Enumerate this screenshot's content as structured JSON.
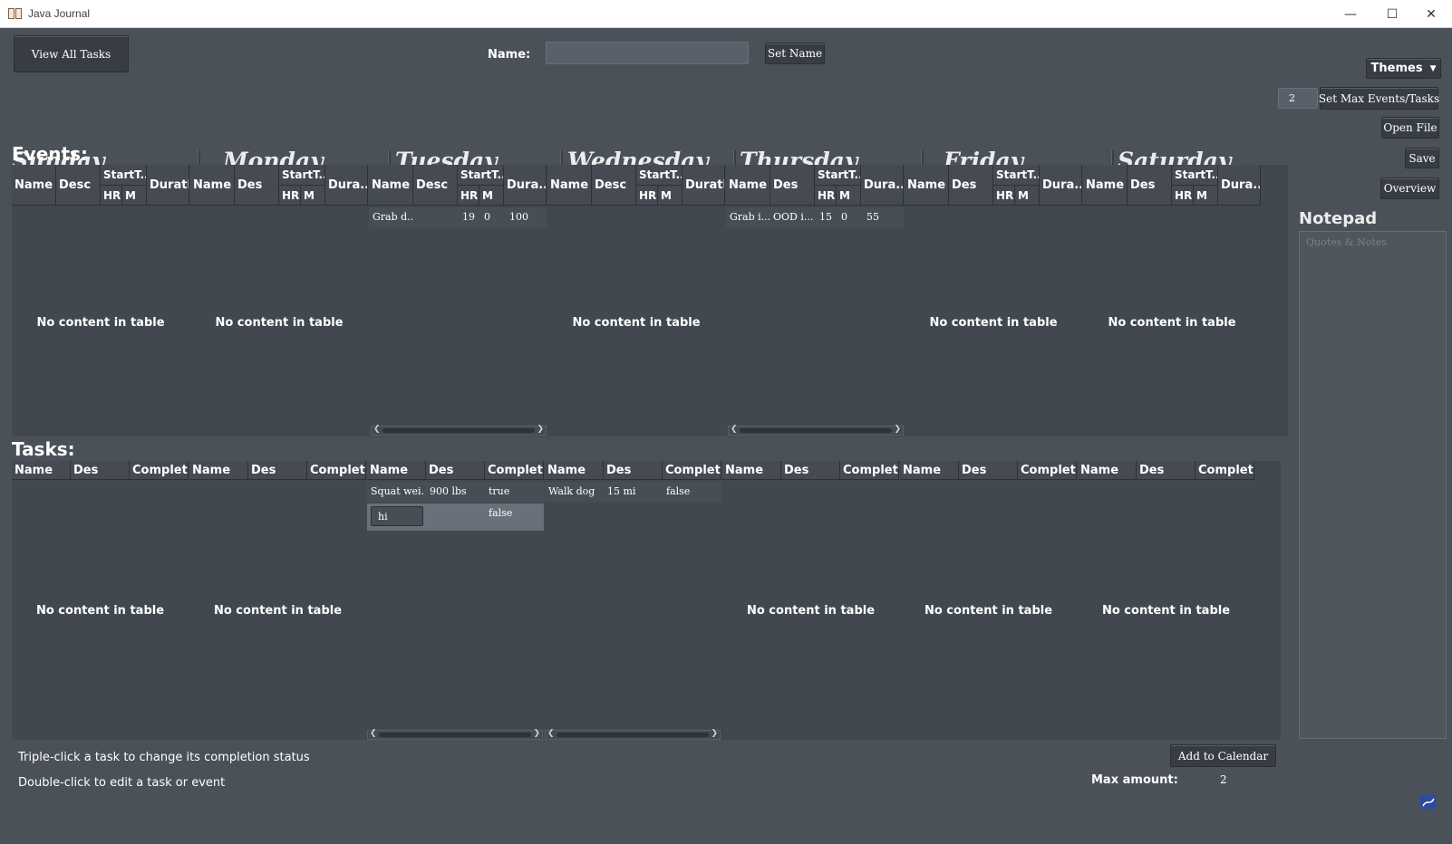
{
  "window": {
    "title": "Java Journal"
  },
  "toolbar": {
    "view_all_tasks": "View All Tasks",
    "name_label": "Name:",
    "name_value": "",
    "set_name": "Set Name",
    "themes": "Themes",
    "max_events_value": "2",
    "set_max": "Set Max Events/Tasks",
    "open_file": "Open File",
    "save": "Save",
    "overview": "Overview"
  },
  "days": [
    "Sunday",
    "Monday",
    "Tuesday",
    "Wednesday",
    "Thursday",
    "Friday",
    "Saturday"
  ],
  "events": {
    "title": "Events:",
    "empty_text": "No content in table",
    "columns": [
      {
        "name": "Name",
        "desc": "Desc",
        "start": "StartT...",
        "hr": "HR",
        "m": "M",
        "dur": "Duratic"
      },
      {
        "name": "Name",
        "desc": "Des",
        "start": "StartT...",
        "hr": "HR",
        "m": "M",
        "dur": "Dura..."
      },
      {
        "name": "Name",
        "desc": "Desc",
        "start": "StartT...",
        "hr": "HR",
        "m": "M",
        "dur": "Dura..."
      },
      {
        "name": "Name",
        "desc": "Desc",
        "start": "StartT...",
        "hr": "HR",
        "m": "M",
        "dur": "Duratic"
      },
      {
        "name": "Name",
        "desc": "Des",
        "start": "StartT...",
        "hr": "HR",
        "m": "M",
        "dur": "Dura..."
      },
      {
        "name": "Name",
        "desc": "Des",
        "start": "StartT...",
        "hr": "HR",
        "m": "M",
        "dur": "Dura..."
      },
      {
        "name": "Name",
        "desc": "Des",
        "start": "StartT...",
        "hr": "HR",
        "m": "M",
        "dur": "Dura..."
      }
    ],
    "tuesday_row": {
      "name": "Grab d...",
      "desc": "",
      "hr": "19",
      "m": "0",
      "dur": "100"
    },
    "thursday_row": {
      "name": "Grab i...",
      "desc": "OOD i...",
      "hr": "15",
      "m": "0",
      "dur": "55"
    }
  },
  "tasks": {
    "title": "Tasks:",
    "empty_text": "No content in table",
    "columns": [
      {
        "name": "Name",
        "des": "Des",
        "complete": "Complete"
      },
      {
        "name": "Name",
        "des": "Des",
        "complete": "Complete"
      },
      {
        "name": "Name",
        "des": "Des",
        "complete": "Complete"
      },
      {
        "name": "Name",
        "des": "Des",
        "complete": "Complete"
      },
      {
        "name": "Name",
        "des": "Des",
        "complete": "Complete"
      },
      {
        "name": "Name",
        "des": "Des",
        "complete": "Complete"
      },
      {
        "name": "Name",
        "des": "Des",
        "complete": "Complete"
      }
    ],
    "tuesday_rows": [
      {
        "name": "Squat wei...",
        "des": "900 lbs",
        "complete": "true"
      },
      {
        "name": "hi",
        "des": "",
        "complete": "false"
      }
    ],
    "wednesday_rows": [
      {
        "name": "Walk dog",
        "des": "15 mi",
        "complete": "false"
      }
    ]
  },
  "notepad": {
    "title": "Notepad",
    "placeholder": "Quotes & Notes"
  },
  "footer": {
    "hint1": "Triple-click a task to change its completion status",
    "hint2": "Double-click to edit a task or event",
    "add_to_calendar": "Add to Calendar",
    "max_amount_label": "Max amount:",
    "max_amount_value": "2"
  },
  "colors": {
    "background": "#4b5159",
    "table": "#424850",
    "button": "#383d44"
  }
}
